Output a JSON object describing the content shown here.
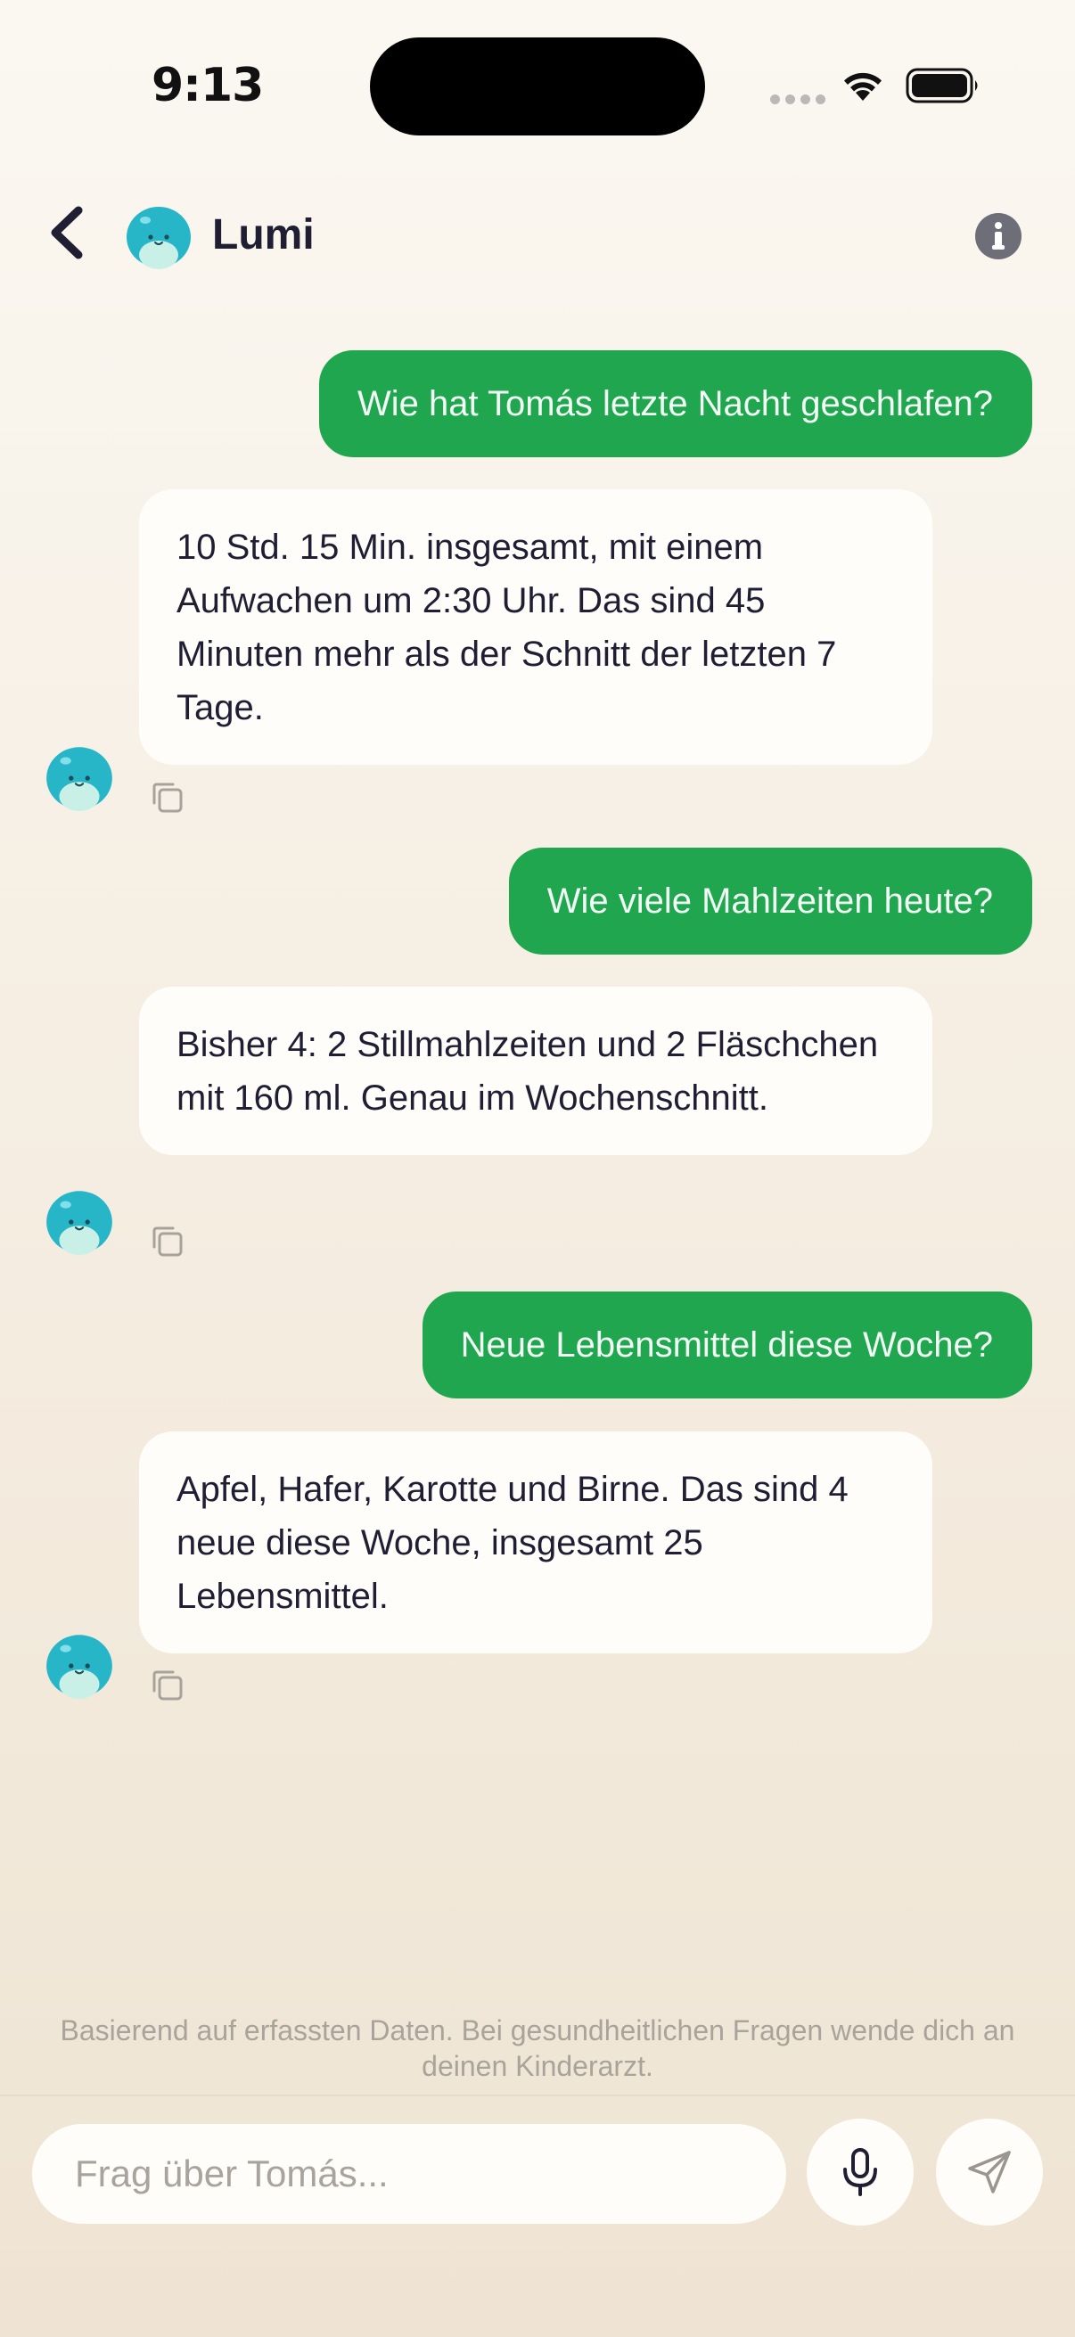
{
  "status_bar": {
    "time": "9:13"
  },
  "header": {
    "title": "Lumi"
  },
  "messages": [
    {
      "role": "user",
      "text": "Wie hat Tomás letzte Nacht geschlafen?"
    },
    {
      "role": "assistant",
      "text": "10 Std. 15 Min. insgesamt, mit einem Aufwachen um 2:30 Uhr. Das sind 45 Minuten mehr als der Schnitt der letzten 7 Tage."
    },
    {
      "role": "user",
      "text": "Wie viele Mahlzeiten heute?"
    },
    {
      "role": "assistant",
      "text": "Bisher 4: 2 Stillmahlzeiten und 2 Fläschchen mit 160 ml. Genau im Wochenschnitt."
    },
    {
      "role": "user",
      "text": "Neue Lebensmittel diese Woche?"
    },
    {
      "role": "assistant",
      "text": "Apfel, Hafer, Karotte und Birne. Das sind 4 neue diese Woche, insgesamt 25 Lebensmittel."
    }
  ],
  "disclaimer": "Basierend auf erfassten Daten. Bei gesundheitlichen Fragen wende dich an deinen Kinderarzt.",
  "composer": {
    "placeholder": "Frag über Tomás...",
    "value": ""
  },
  "icons": {
    "back": "chevron-left-icon",
    "info": "info-icon",
    "copy": "copy-icon",
    "mic": "microphone-icon",
    "send": "send-icon",
    "avatar": "lumi-mascot-avatar"
  },
  "colors": {
    "user_bubble": "#1fa64f",
    "bot_bubble": "#fffdf9",
    "avatar": "#27b5c8",
    "text_primary": "#1f1e33",
    "muted": "#a9a39b"
  }
}
